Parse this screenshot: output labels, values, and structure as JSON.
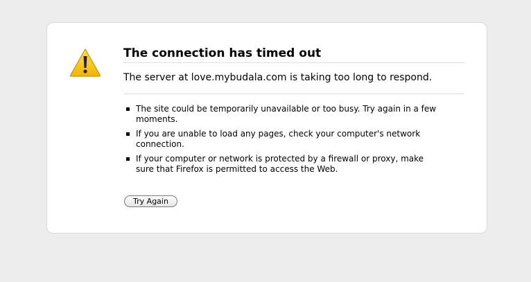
{
  "error": {
    "title": "The connection has timed out",
    "short_desc": "The server at love.mybudala.com is taking too long to respond.",
    "suggestions": [
      "The site could be temporarily unavailable or too busy. Try again in a few moments.",
      "If you are unable to load any pages, check your computer's network connection.",
      "If your computer or network is protected by a firewall or proxy, make sure that Firefox is permitted to access the Web."
    ],
    "try_again_label": "Try Again",
    "icon": "warning-icon"
  },
  "colors": {
    "page_background": "#ededed",
    "box_background": "#ffffff",
    "warning_yellow": "#f5c400"
  }
}
